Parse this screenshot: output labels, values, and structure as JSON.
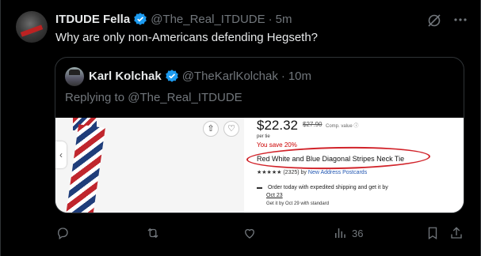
{
  "tweet": {
    "author_name": "ITDUDE Fella",
    "handle": "@The_Real_ITDUDE",
    "separator": "·",
    "time": "5m",
    "text": "Why are only non-Americans defending Hegseth?"
  },
  "quote": {
    "author_name": "Karl Kolchak",
    "handle": "@TheKarlKolchak",
    "separator": "·",
    "time": "10m",
    "replying_to": "Replying to @The_Real_ITDUDE",
    "product": {
      "price": "$22.32",
      "old_price": "$27.90",
      "comp_value": "Comp. value ⓘ",
      "per_unit": "per tie",
      "you_save": "You save 20%",
      "title": "Red White and Blue Diagonal Stripes Neck Tie",
      "stars": "★★★★★",
      "rating_count": "(2325)",
      "by_label": "by",
      "seller": "New Address Postcards",
      "shipping_line1": "Order today with expedited shipping and get it by",
      "shipping_date": "Oct 23",
      "shipping_standard": "Get it by Oct 29 with standard"
    }
  },
  "actions": {
    "views_count": "36"
  },
  "icons": {
    "verified": "verified-badge-icon",
    "grok": "grok-icon",
    "more": "more-icon",
    "reply": "reply-icon",
    "retweet": "retweet-icon",
    "like": "like-icon",
    "views": "views-icon",
    "bookmark": "bookmark-icon",
    "share": "share-icon",
    "product_share": "share-icon",
    "product_like": "heart-icon"
  },
  "colors": {
    "background": "#000000",
    "text": "#e7e9ea",
    "secondary": "#71767b",
    "verified": "#1d9bf0",
    "border": "#2f3336",
    "highlight_circle": "#d1232a",
    "save_text": "#cc0000"
  }
}
